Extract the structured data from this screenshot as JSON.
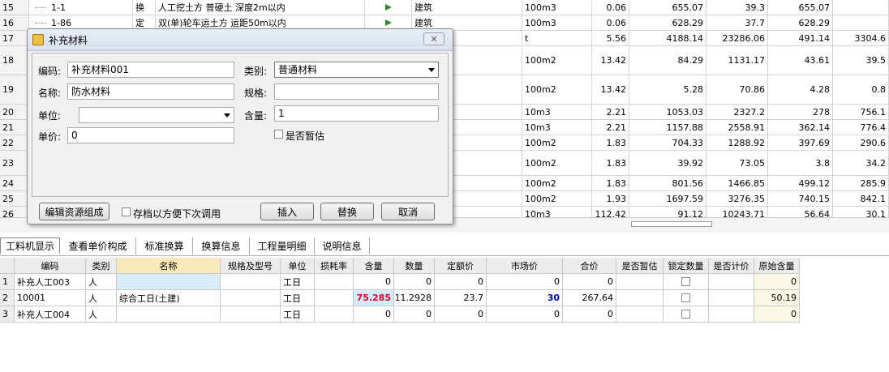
{
  "top_grid": {
    "rows": [
      {
        "num": "15",
        "code": "1-1",
        "type": "换",
        "name": "人工挖土方 普硬土 深度2m以内",
        "flag": true,
        "prof": "建筑",
        "unit": "100m3",
        "qty": "0.06",
        "c1": "655.07",
        "c2": "39.3",
        "c3": "655.07",
        "c4": ""
      },
      {
        "num": "16",
        "code": "1-86",
        "type": "定",
        "name": "双(单)轮车运土方 运距50m以内",
        "flag": true,
        "prof": "建筑",
        "unit": "100m3",
        "qty": "0.06",
        "c1": "628.29",
        "c2": "37.7",
        "c3": "628.29",
        "c4": ""
      },
      {
        "num": "17",
        "code": "",
        "type": "",
        "name": "",
        "flag": false,
        "prof": "",
        "unit": "t",
        "qty": "5.56",
        "c1": "4188.14",
        "c2": "23286.06",
        "c3": "491.14",
        "c4": "3304.6"
      },
      {
        "num": "18",
        "code": "",
        "type": "",
        "name": "",
        "flag": false,
        "prof": "",
        "unit": "100m2",
        "qty": "13.42",
        "c1": "84.29",
        "c2": "1131.17",
        "c3": "43.61",
        "c4": "39.5"
      },
      {
        "num": "19",
        "code": "",
        "type": "",
        "name": "",
        "flag": false,
        "prof": "",
        "unit": "100m2",
        "qty": "13.42",
        "c1": "5.28",
        "c2": "70.86",
        "c3": "4.28",
        "c4": "0.8"
      },
      {
        "num": "20",
        "code": "",
        "type": "",
        "name": "",
        "flag": false,
        "prof": "",
        "unit": "10m3",
        "qty": "2.21",
        "c1": "1053.03",
        "c2": "2327.2",
        "c3": "278",
        "c4": "756.1"
      },
      {
        "num": "21",
        "code": "",
        "type": "",
        "name": "",
        "flag": false,
        "prof": "",
        "unit": "10m3",
        "qty": "2.21",
        "c1": "1157.88",
        "c2": "2558.91",
        "c3": "362.14",
        "c4": "776.4"
      },
      {
        "num": "22",
        "code": "",
        "type": "",
        "name": "",
        "flag": false,
        "prof": "",
        "unit": "100m2",
        "qty": "1.83",
        "c1": "704.33",
        "c2": "1288.92",
        "c3": "397.69",
        "c4": "290.6"
      },
      {
        "num": "23",
        "code": "",
        "type": "",
        "name": "",
        "flag": false,
        "prof": "",
        "unit": "100m2",
        "qty": "1.83",
        "c1": "39.92",
        "c2": "73.05",
        "c3": "3.8",
        "c4": "34.2"
      },
      {
        "num": "24",
        "code": "",
        "type": "",
        "name": "",
        "flag": false,
        "prof": "",
        "unit": "100m2",
        "qty": "1.83",
        "c1": "801.56",
        "c2": "1466.85",
        "c3": "499.12",
        "c4": "285.9"
      },
      {
        "num": "25",
        "code": "",
        "type": "",
        "name": "",
        "flag": false,
        "prof": "",
        "unit": "100m2",
        "qty": "1.93",
        "c1": "1697.59",
        "c2": "3276.35",
        "c3": "740.15",
        "c4": "842.1"
      },
      {
        "num": "26",
        "code": "",
        "type": "",
        "name": "",
        "flag": false,
        "prof": "",
        "unit": "10m3",
        "qty": "112.42",
        "c1": "91.12",
        "c2": "10243.71",
        "c3": "56.64",
        "c4": "30.1"
      }
    ]
  },
  "tabs": [
    "工料机显示",
    "查看单价构成",
    "标准换算",
    "换算信息",
    "工程量明细",
    "说明信息"
  ],
  "bottom_grid": {
    "headers": [
      "编码",
      "类别",
      "名称",
      "规格及型号",
      "单位",
      "损耗率",
      "含量",
      "数量",
      "定额价",
      "市场价",
      "合价",
      "是否暂估",
      "锁定数量",
      "是否计价",
      "原始含量"
    ],
    "rows": [
      {
        "num": "1",
        "code": "补充人工003",
        "type": "人",
        "name": "",
        "spec": "",
        "unit": "工日",
        "loss": "",
        "content": "0",
        "qty": "0",
        "price": "0",
        "market": "0",
        "total": "0",
        "orig": "0"
      },
      {
        "num": "2",
        "code": "10001",
        "type": "人",
        "name": "综合工日(土建)",
        "spec": "",
        "unit": "工日",
        "loss": "",
        "content": "75.285",
        "qty": "11.2928",
        "price": "23.7",
        "market": "30",
        "total": "267.64",
        "orig": "50.19"
      },
      {
        "num": "3",
        "code": "补充人工004",
        "type": "人",
        "name": "",
        "spec": "",
        "unit": "工日",
        "loss": "",
        "content": "0",
        "qty": "0",
        "price": "0",
        "market": "0",
        "total": "0",
        "orig": "0"
      }
    ]
  },
  "dialog": {
    "title": "补充材料",
    "code_label": "编码:",
    "code_value": "补充材料001",
    "category_label": "类别:",
    "category_value": "普通材料",
    "name_label": "名称:",
    "name_value": "防水材料",
    "spec_label": "规格:",
    "spec_value": "",
    "unit_label": "单位:",
    "unit_value": "",
    "content_label": "含量:",
    "content_value": "1",
    "price_label": "单价:",
    "price_value": "0",
    "provisional_label": "是否暂估",
    "edit_button": "编辑资源组成",
    "save_label": "存档以方便下次调用",
    "insert_button": "插入",
    "replace_button": "替换",
    "cancel_button": "取消"
  },
  "colors": {
    "content_highlight": "#d4ecfa",
    "content_text": "#e0002a",
    "market_text": "#0000cc",
    "dialog_bg": "#f0f0f0"
  }
}
